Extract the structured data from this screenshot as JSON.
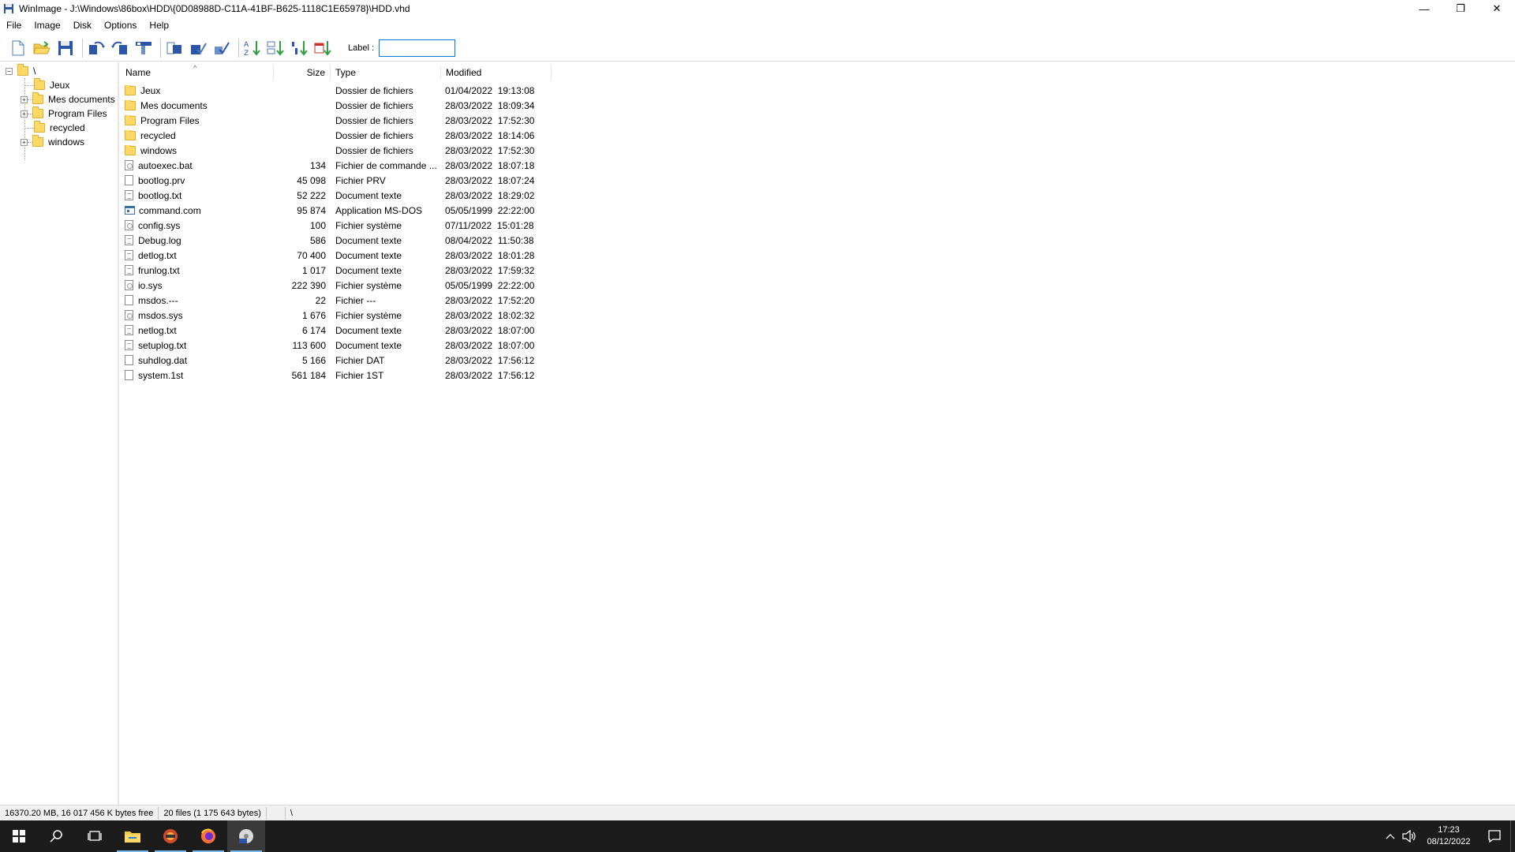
{
  "window": {
    "title": "WinImage - J:\\Windows\\86box\\HDD\\{0D08988D-C11A-41BF-B625-1118C1E65978}\\HDD.vhd",
    "minimize": "—",
    "restore": "❐",
    "close": "✕"
  },
  "menu": [
    "File",
    "Image",
    "Disk",
    "Options",
    "Help"
  ],
  "toolbar": {
    "label_text": "Label :",
    "label_value": ""
  },
  "tree": {
    "root": "\\",
    "items": [
      {
        "label": "Jeux",
        "expandable": false
      },
      {
        "label": "Mes documents",
        "expandable": true
      },
      {
        "label": "Program Files",
        "expandable": true
      },
      {
        "label": "recycled",
        "expandable": false
      },
      {
        "label": "windows",
        "expandable": true
      }
    ]
  },
  "list": {
    "headers": {
      "name": "Name",
      "size": "Size",
      "type": "Type",
      "modified": "Modified"
    },
    "rows": [
      {
        "icon": "folder",
        "name": "Jeux",
        "size": "",
        "type": "Dossier de fichiers",
        "modified": "01/04/2022  19:13:08"
      },
      {
        "icon": "folder",
        "name": "Mes documents",
        "size": "",
        "type": "Dossier de fichiers",
        "modified": "28/03/2022  18:09:34"
      },
      {
        "icon": "folder",
        "name": "Program Files",
        "size": "",
        "type": "Dossier de fichiers",
        "modified": "28/03/2022  17:52:30"
      },
      {
        "icon": "folder",
        "name": "recycled",
        "size": "",
        "type": "Dossier de fichiers",
        "modified": "28/03/2022  18:14:06"
      },
      {
        "icon": "folder",
        "name": "windows",
        "size": "",
        "type": "Dossier de fichiers",
        "modified": "28/03/2022  17:52:30"
      },
      {
        "icon": "cfg",
        "name": "autoexec.bat",
        "size": "134",
        "type": "Fichier de commande ...",
        "modified": "28/03/2022  18:07:18"
      },
      {
        "icon": "file",
        "name": "bootlog.prv",
        "size": "45 098",
        "type": "Fichier PRV",
        "modified": "28/03/2022  18:07:24"
      },
      {
        "icon": "text",
        "name": "bootlog.txt",
        "size": "52 222",
        "type": "Document texte",
        "modified": "28/03/2022  18:29:02"
      },
      {
        "icon": "app",
        "name": "command.com",
        "size": "95 874",
        "type": "Application MS-DOS",
        "modified": "05/05/1999  22:22:00"
      },
      {
        "icon": "cfg",
        "name": "config.sys",
        "size": "100",
        "type": "Fichier système",
        "modified": "07/11/2022  15:01:28"
      },
      {
        "icon": "text",
        "name": "Debug.log",
        "size": "586",
        "type": "Document texte",
        "modified": "08/04/2022  11:50:38"
      },
      {
        "icon": "text",
        "name": "detlog.txt",
        "size": "70 400",
        "type": "Document texte",
        "modified": "28/03/2022  18:01:28"
      },
      {
        "icon": "text",
        "name": "frunlog.txt",
        "size": "1 017",
        "type": "Document texte",
        "modified": "28/03/2022  17:59:32"
      },
      {
        "icon": "cfg",
        "name": "io.sys",
        "size": "222 390",
        "type": "Fichier système",
        "modified": "05/05/1999  22:22:00"
      },
      {
        "icon": "file",
        "name": "msdos.---",
        "size": "22",
        "type": "Fichier ---",
        "modified": "28/03/2022  17:52:20"
      },
      {
        "icon": "cfg",
        "name": "msdos.sys",
        "size": "1 676",
        "type": "Fichier système",
        "modified": "28/03/2022  18:02:32"
      },
      {
        "icon": "text",
        "name": "netlog.txt",
        "size": "6 174",
        "type": "Document texte",
        "modified": "28/03/2022  18:07:00"
      },
      {
        "icon": "text",
        "name": "setuplog.txt",
        "size": "113 600",
        "type": "Document texte",
        "modified": "28/03/2022  18:07:00"
      },
      {
        "icon": "file",
        "name": "suhdlog.dat",
        "size": "5 166",
        "type": "Fichier DAT",
        "modified": "28/03/2022  17:56:12"
      },
      {
        "icon": "file",
        "name": "system.1st",
        "size": "561 184",
        "type": "Fichier 1ST",
        "modified": "28/03/2022  17:56:12"
      }
    ]
  },
  "status": {
    "free": "16370.20 MB, 16 017 456 K bytes free",
    "files": "20 files (1 175 643 bytes)",
    "blank": "",
    "path": "\\"
  },
  "taskbar": {
    "time": "17:23",
    "date": "08/12/2022"
  },
  "colors": {
    "folder": "#ffd866",
    "accent": "#0078d7",
    "taskbar": "#1c1c1c"
  }
}
